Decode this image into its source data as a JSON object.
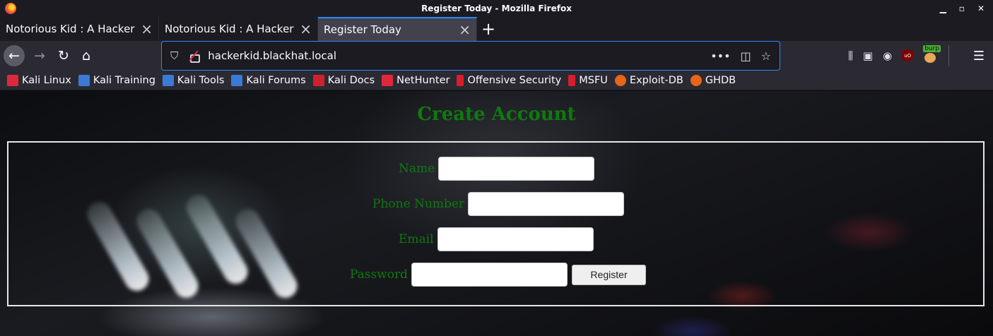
{
  "window": {
    "title": "Register Today - Mozilla Firefox"
  },
  "tabs": [
    {
      "label": "Notorious Kid : A Hacker"
    },
    {
      "label": "Notorious Kid : A Hacker"
    },
    {
      "label": "Register Today"
    }
  ],
  "urlbar": {
    "url": "hackerkid.blackhat.local"
  },
  "extensions": {
    "burp_badge": "burp",
    "ublock_label": "uO"
  },
  "bookmarks": [
    {
      "label": "Kali Linux",
      "color": "#e0283c"
    },
    {
      "label": "Kali Training",
      "color": "#3b7bd6"
    },
    {
      "label": "Kali Tools",
      "color": "#3b7bd6"
    },
    {
      "label": "Kali Forums",
      "color": "#3b7bd6"
    },
    {
      "label": "Kali Docs",
      "color": "#d0202e"
    },
    {
      "label": "NetHunter",
      "color": "#e0283c"
    },
    {
      "label": "Offensive Security",
      "color": "#d81e2a"
    },
    {
      "label": "MSFU",
      "color": "#d81e2a"
    },
    {
      "label": "Exploit-DB",
      "color": "#e8651a"
    },
    {
      "label": "GHDB",
      "color": "#e8651a"
    }
  ],
  "page": {
    "heading": "Create Account",
    "form": {
      "name_label": "Name",
      "phone_label": "Phone Number",
      "email_label": "Email",
      "password_label": "Password",
      "submit_label": "Register"
    }
  },
  "colors": {
    "accent": "#2a8af5",
    "heading_green": "#0e7a0e"
  }
}
